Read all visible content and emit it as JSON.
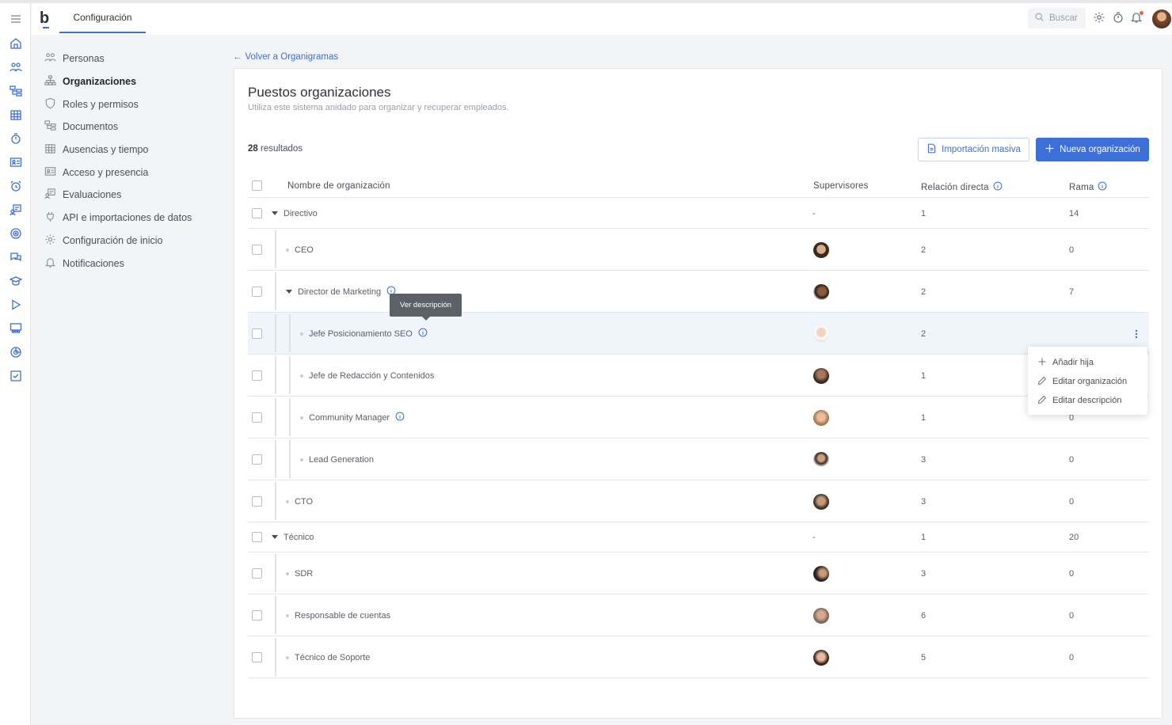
{
  "topbar": {
    "tab": "Configuración",
    "search_placeholder": "Buscar",
    "logo": "b"
  },
  "sidebar": {
    "items": [
      {
        "label": "Personas",
        "icon": "people-icon"
      },
      {
        "label": "Organizaciones",
        "icon": "org-chart-icon",
        "active": true
      },
      {
        "label": "Roles y permisos",
        "icon": "shield-icon"
      },
      {
        "label": "Documentos",
        "icon": "folder-tree-icon"
      },
      {
        "label": "Ausencias y tiempo",
        "icon": "calendar-icon"
      },
      {
        "label": "Acceso y presencia",
        "icon": "id-card-icon"
      },
      {
        "label": "Evaluaciones",
        "icon": "review-icon"
      },
      {
        "label": "API e importaciones de datos",
        "icon": "plug-icon"
      },
      {
        "label": "Configuración de inicio",
        "icon": "gear-icon"
      },
      {
        "label": "Notificaciones",
        "icon": "bell-icon"
      }
    ]
  },
  "back_link": "Volver a Organigramas",
  "main": {
    "title": "Puestos organizaciones",
    "subtitle": "Utiliza este sistema anidado para organizar y recuperar empleados.",
    "results_count": "28",
    "results_label": "resultados",
    "import_button": "Importación masiva",
    "new_button": "Nueva organización"
  },
  "table": {
    "columns": {
      "name": "Nombre de organización",
      "supervisors": "Supervisores",
      "direct": "Relación directa",
      "branch": "Rama"
    },
    "rows": [
      {
        "name": "Directivo",
        "supervisor": "-",
        "direct": "1",
        "branch": "14",
        "level": 0,
        "group": true
      },
      {
        "name": "CEO",
        "supervisor": "",
        "direct": "2",
        "branch": "0",
        "level": 1
      },
      {
        "name": "Director de Marketing",
        "supervisor": "",
        "direct": "2",
        "branch": "7",
        "level": 1,
        "group": true,
        "info": true
      },
      {
        "name": "Jefe Posicionamiento SEO",
        "supervisor": "",
        "direct": "2",
        "branch": "",
        "level": 2,
        "info": true,
        "highlighted": true
      },
      {
        "name": "Jefe de Redacción y Contenidos",
        "supervisor": "",
        "direct": "1",
        "branch": "",
        "level": 2
      },
      {
        "name": "Community Manager",
        "supervisor": "",
        "direct": "1",
        "branch": "0",
        "level": 2,
        "info": true
      },
      {
        "name": "Lead Generation",
        "supervisor": "",
        "direct": "3",
        "branch": "0",
        "level": 2
      },
      {
        "name": "CTO",
        "supervisor": "",
        "direct": "3",
        "branch": "0",
        "level": 1
      },
      {
        "name": "Técnico",
        "supervisor": "-",
        "direct": "1",
        "branch": "20",
        "level": 0,
        "group": true
      },
      {
        "name": "SDR",
        "supervisor": "",
        "direct": "3",
        "branch": "0",
        "level": 1
      },
      {
        "name": "Responsable de cuentas",
        "supervisor": "",
        "direct": "6",
        "branch": "0",
        "level": 1
      },
      {
        "name": "Técnico de Soporte",
        "supervisor": "",
        "direct": "5",
        "branch": "0",
        "level": 1
      }
    ]
  },
  "tooltip": "Ver descripción",
  "row_menu": {
    "items": [
      "Añadir hija",
      "Editar organización",
      "Editar descripción"
    ]
  },
  "colors": {
    "accent": "#3d6fd8",
    "highlight_row": "#f0f4fb"
  }
}
